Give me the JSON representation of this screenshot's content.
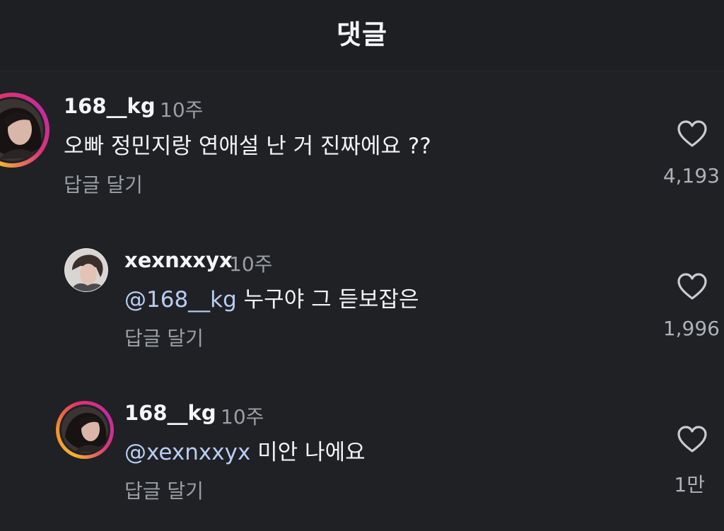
{
  "header": {
    "title": "댓글"
  },
  "comments": [
    {
      "username": "168__kg",
      "time": "10주",
      "mention": "",
      "text": "오빠 정민지랑 연애설 난 거 진짜에요 ??",
      "reply_label": "답글 달기",
      "likes": "4,193",
      "story_ring": true
    },
    {
      "username": "xexnxxyx",
      "time": "10주",
      "mention": "@168__kg",
      "text": " 누구야 그 듣보잡은",
      "reply_label": "답글 달기",
      "likes": "1,996",
      "story_ring": false
    },
    {
      "username": "168__kg",
      "time": "10주",
      "mention": "@xexnxxyx",
      "text": " 미안 나에요",
      "reply_label": "답글 달기",
      "likes": "1만",
      "story_ring": true
    }
  ],
  "colors": {
    "background": "#1f2125",
    "text": "#f1f2f4",
    "secondary_text": "#9b9ea5",
    "mention": "#b9cdf2"
  }
}
